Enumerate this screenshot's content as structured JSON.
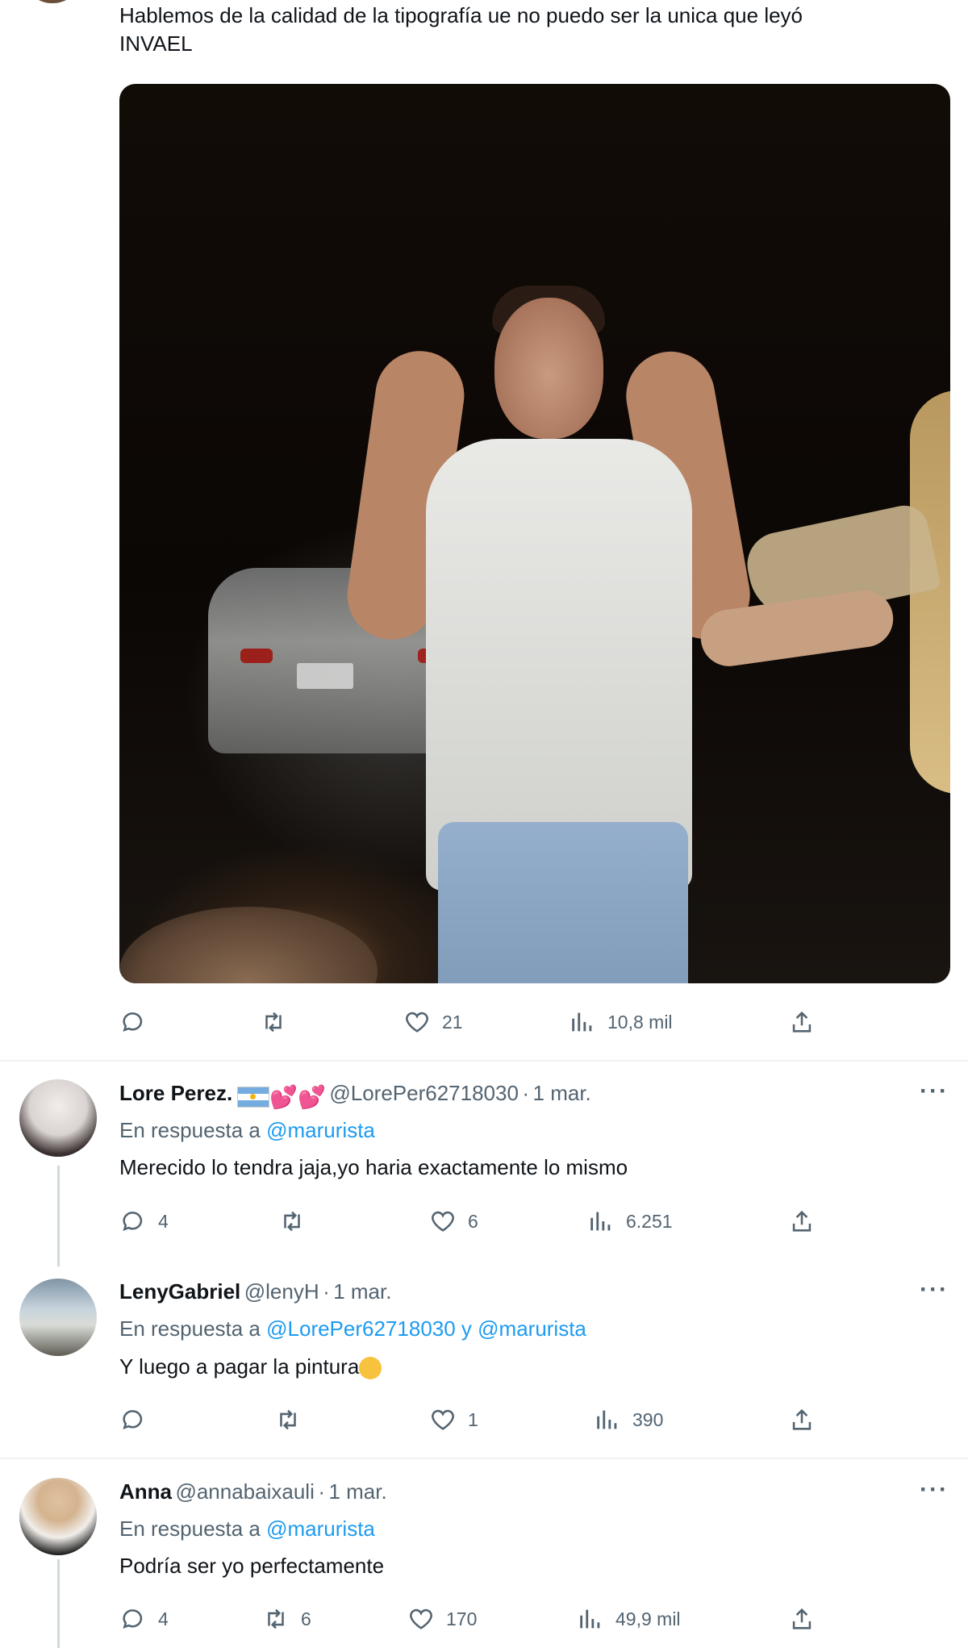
{
  "main_tweet": {
    "text_line1": "Hablemos de la calidad de la tipografía ue no puedo ser la unica que leyó",
    "text_line2": "INVAEL",
    "actions": {
      "replies": "",
      "retweets": "",
      "likes": "21",
      "views": "10,8 mil"
    }
  },
  "replies": [
    {
      "name": "Lore Perez.",
      "handle": "@LorePer62718030",
      "date": "1 mar.",
      "reply_prefix": "En respuesta a",
      "reply_to": "@marurista",
      "text": "Merecido lo tendra jaja,yo haria exactamente lo mismo",
      "actions": {
        "replies": "4",
        "retweets": "",
        "likes": "6",
        "views": "6.251"
      }
    },
    {
      "name": "LenyGabriel",
      "handle": "@lenyH",
      "date": "1 mar.",
      "reply_prefix": "En respuesta a",
      "reply_to": "@LorePer62718030 y @marurista",
      "text": "Y luego a pagar la pintura",
      "actions": {
        "replies": "",
        "retweets": "",
        "likes": "1",
        "views": "390"
      }
    },
    {
      "name": "Anna",
      "handle": "@annabaixauli",
      "date": "1 mar.",
      "reply_prefix": "En respuesta a",
      "reply_to": "@marurista",
      "text": "Podría ser yo perfectamente",
      "actions": {
        "replies": "4",
        "retweets": "6",
        "likes": "170",
        "views": "49,9 mil"
      }
    }
  ],
  "ui": {
    "more_label": "···",
    "dot": "·"
  },
  "colors": {
    "text": "#0f1419",
    "secondary": "#536471",
    "link": "#1d9bf0",
    "divider": "#eff3f4"
  },
  "icons": [
    "reply-icon",
    "retweet-icon",
    "like-icon",
    "views-icon",
    "share-icon",
    "more-icon"
  ]
}
